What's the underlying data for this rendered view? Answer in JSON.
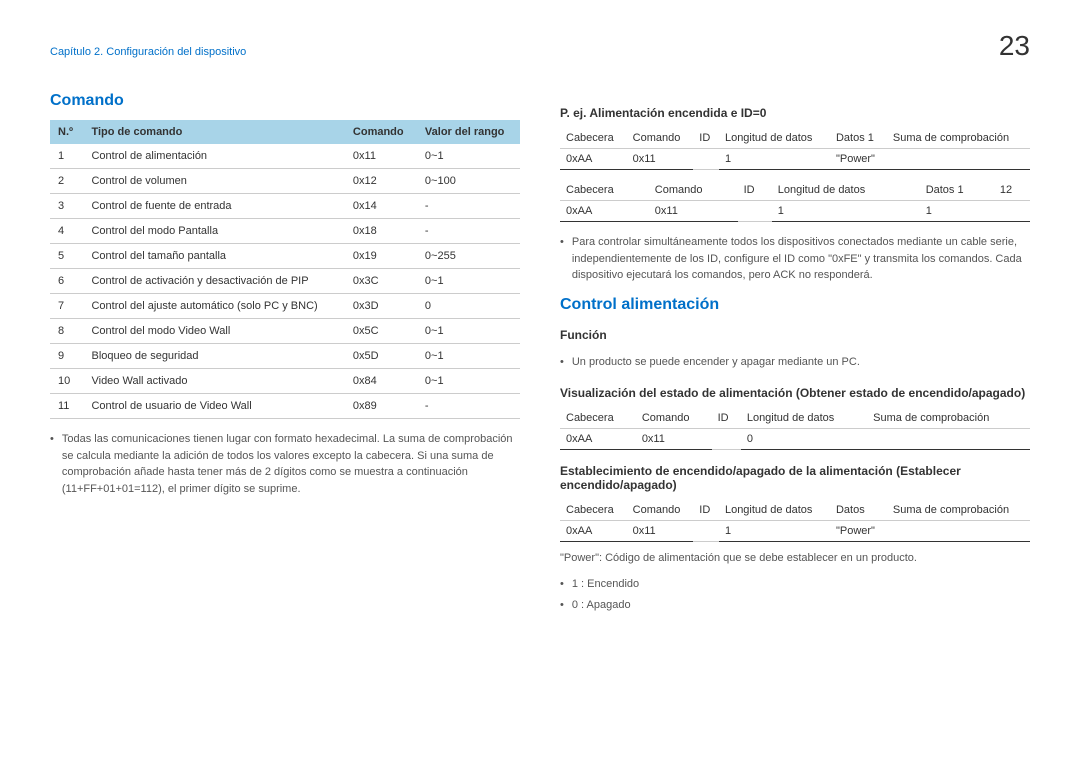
{
  "header": {
    "breadcrumb": "Capítulo 2. Configuración del dispositivo",
    "pageNum": "23"
  },
  "left": {
    "title": "Comando",
    "cols": [
      "N.º",
      "Tipo de comando",
      "Comando",
      "Valor del rango"
    ],
    "rows": [
      [
        "1",
        "Control de alimentación",
        "0x11",
        "0~1"
      ],
      [
        "2",
        "Control de volumen",
        "0x12",
        "0~100"
      ],
      [
        "3",
        "Control de fuente de entrada",
        "0x14",
        "-"
      ],
      [
        "4",
        "Control del modo Pantalla",
        "0x18",
        "-"
      ],
      [
        "5",
        "Control del tamaño pantalla",
        "0x19",
        "0~255"
      ],
      [
        "6",
        "Control de activación y desactivación de PIP",
        "0x3C",
        "0~1"
      ],
      [
        "7",
        "Control del ajuste automático (solo PC y BNC)",
        "0x3D",
        "0"
      ],
      [
        "8",
        "Control del modo Video Wall",
        "0x5C",
        "0~1"
      ],
      [
        "9",
        "Bloqueo de seguridad",
        "0x5D",
        "0~1"
      ],
      [
        "10",
        "Video Wall activado",
        "0x84",
        "0~1"
      ],
      [
        "11",
        "Control de usuario de Video Wall",
        "0x89",
        "-"
      ]
    ],
    "note": "Todas las comunicaciones tienen lugar con formato hexadecimal. La suma de comprobación se calcula mediante la adición de todos los valores excepto la cabecera. Si una suma de comprobación añade hasta tener más de 2 dígitos como se muestra a continuación (11+FF+01+01=112), el primer dígito se suprime."
  },
  "right": {
    "ex_title": "P. ej. Alimentación encendida e ID=0",
    "t1h": [
      "Cabecera",
      "Comando",
      "ID",
      "Longitud de datos",
      "Datos 1",
      "Suma de comprobación"
    ],
    "t1d": [
      "0xAA",
      "0x11",
      "",
      "1",
      "\"Power\"",
      ""
    ],
    "t2h": [
      "Cabecera",
      "Comando",
      "ID",
      "Longitud de datos",
      "Datos 1",
      "12"
    ],
    "t2d": [
      "0xAA",
      "0x11",
      "",
      "1",
      "1",
      ""
    ],
    "note1": "Para controlar simultáneamente todos los dispositivos conectados mediante un cable serie, independientemente de los ID, configure el ID como \"0xFE\" y transmita los comandos. Cada dispositivo ejecutará los comandos, pero ACK no responderá.",
    "ctrl_title": "Control alimentación",
    "funcion": "Función",
    "funcion_note": "Un producto se puede encender y apagar mediante un PC.",
    "vis_title": "Visualización del estado de alimentación (Obtener estado de encendido/apagado)",
    "t3h": [
      "Cabecera",
      "Comando",
      "ID",
      "Longitud de datos",
      "Suma de comprobación"
    ],
    "t3d": [
      "0xAA",
      "0x11",
      "",
      "0",
      ""
    ],
    "est_title": "Establecimiento de encendido/apagado de la alimentación (Establecer encendido/apagado)",
    "t4h": [
      "Cabecera",
      "Comando",
      "ID",
      "Longitud de datos",
      "Datos",
      "Suma de comprobación"
    ],
    "t4d": [
      "0xAA",
      "0x11",
      "",
      "1",
      "\"Power\"",
      ""
    ],
    "power_note": "\"Power\": Código de alimentación que se debe establecer en un producto.",
    "enc": "1 : Encendido",
    "apa": "0 : Apagado"
  }
}
